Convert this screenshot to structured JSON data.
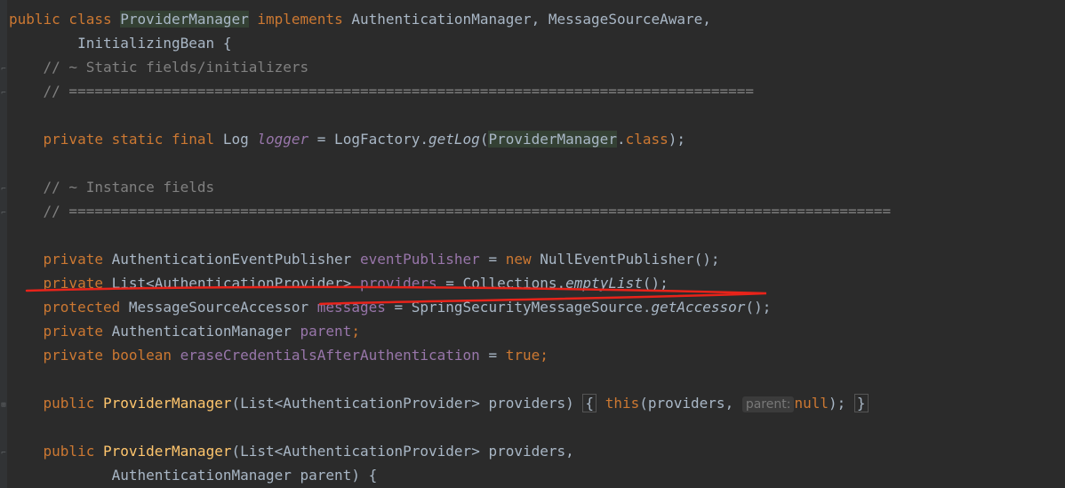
{
  "colors": {
    "background": "#2b2b2b",
    "keyword": "#cc7832",
    "comment": "#808080",
    "field": "#9876aa",
    "method_decl": "#ffc66d",
    "plain": "#a9b7c6",
    "identifier_highlight": "#344134",
    "annotation_stroke": "#e8231a"
  },
  "code": {
    "l1": {
      "kw1": "public class ",
      "cls": "ProviderManager",
      "kw2": " implements ",
      "rest": "AuthenticationManager, MessageSourceAware,"
    },
    "l2": {
      "text": "        InitializingBean {"
    },
    "l3": {
      "text": "    // ~ Static fields/initializers"
    },
    "l4": {
      "text": "    // ================================================================================"
    },
    "l5": {
      "indent": "    ",
      "kw": "private static final ",
      "type": "Log ",
      "fld": "logger",
      "mid": " = LogFactory.",
      "call": "getLog",
      "open": "(",
      "cls": "ProviderManager",
      "dot": ".",
      "kw2": "class",
      "end": ");"
    },
    "l6": {
      "text": "    // ~ Instance fields"
    },
    "l7": {
      "text": "    // ================================================================================================"
    },
    "l8": {
      "indent": "    ",
      "kw": "private ",
      "type": "AuthenticationEventPublisher ",
      "fld": "eventPublisher",
      "mid": " = ",
      "kw2": "new ",
      "end": "NullEventPublisher();"
    },
    "l9": {
      "indent": "    ",
      "kw": "private ",
      "type": "List<AuthenticationProvider> ",
      "fld": "providers",
      "mid": " = Collections.",
      "call": "emptyList",
      "end": "();"
    },
    "l10": {
      "indent": "    ",
      "kw": "protected ",
      "type": "MessageSourceAccessor ",
      "fld": "messages",
      "mid": " = SpringSecurityMessageSource.",
      "call": "getAccessor",
      "end": "();"
    },
    "l11": {
      "indent": "    ",
      "kw": "private ",
      "type": "AuthenticationManager ",
      "fld": "parent",
      "end": ";"
    },
    "l12": {
      "indent": "    ",
      "kw": "private boolean ",
      "fld": "eraseCredentialsAfterAuthentication",
      "mid": " = ",
      "kw2": "true",
      "end": ";"
    },
    "l13": {
      "indent": "    ",
      "kw": "public ",
      "fn": "ProviderManager",
      "args": "(List<AuthenticationProvider> providers)",
      "gap": " ",
      "ob": "{",
      "sp": " ",
      "kw2": "this",
      "call": "(providers, ",
      "hint": "parent:",
      "kw3": "null",
      "end": ");",
      "cb": "}"
    },
    "l14": {
      "indent": "    ",
      "kw": "public ",
      "fn": "ProviderManager",
      "args": "(List<AuthenticationProvider> providers,"
    },
    "l15": {
      "text": "            AuthenticationManager parent) {"
    }
  }
}
